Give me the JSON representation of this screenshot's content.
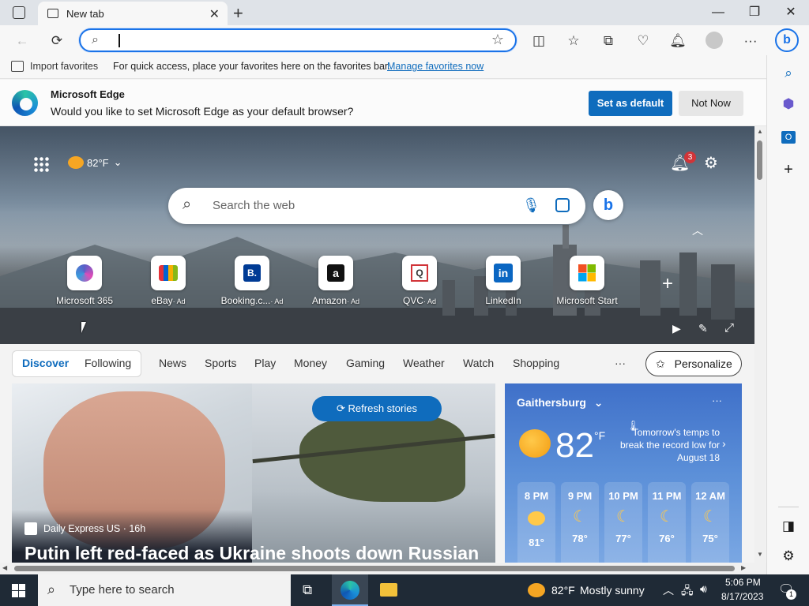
{
  "tab": {
    "title": "New tab"
  },
  "window": {
    "minimize": "—",
    "restore": "❐",
    "close": "✕"
  },
  "favbar": {
    "import_label": "Import favorites",
    "message": "For quick access, place your favorites here on the favorites bar.",
    "manage_link": "Manage favorites now"
  },
  "infobar": {
    "title": "Microsoft Edge",
    "message": "Would you like to set Microsoft Edge as your default browser?",
    "set_default": "Set as default",
    "not_now": "Not Now"
  },
  "hero": {
    "weather_temp": "82°F",
    "notification_count": "3",
    "search_placeholder": "Search the web",
    "quick_links": [
      {
        "name": "Microsoft 365",
        "ad": ""
      },
      {
        "name": "eBay",
        "ad": "· Ad"
      },
      {
        "name": "Booking.c...",
        "ad": "· Ad"
      },
      {
        "name": "Amazon",
        "ad": "· Ad"
      },
      {
        "name": "QVC",
        "ad": "· Ad"
      },
      {
        "name": "LinkedIn",
        "ad": ""
      },
      {
        "name": "Microsoft Start",
        "ad": ""
      }
    ]
  },
  "feednav": {
    "tabs": [
      "Discover",
      "Following"
    ],
    "items": [
      "News",
      "Sports",
      "Play",
      "Money",
      "Gaming",
      "Weather",
      "Watch",
      "Shopping"
    ],
    "more": "···",
    "personalize": "Personalize"
  },
  "story": {
    "refresh": "Refresh stories",
    "source": "Daily Express US · 16h",
    "headline": "Putin left red-faced as Ukraine shoots down Russian"
  },
  "weather_card": {
    "location": "Gaithersburg",
    "temp": "82",
    "unit": "°F",
    "note": "Tomorrow's temps to break the record low for August 18",
    "hours": [
      {
        "time": "8 PM",
        "temp": "81°"
      },
      {
        "time": "9 PM",
        "temp": "78°"
      },
      {
        "time": "10 PM",
        "temp": "77°"
      },
      {
        "time": "11 PM",
        "temp": "76°"
      },
      {
        "time": "12 AM",
        "temp": "75°"
      }
    ]
  },
  "taskbar": {
    "search_placeholder": "Type here to search",
    "weather": "82°F",
    "weather_desc": "Mostly sunny",
    "time": "5:06 PM",
    "date": "8/17/2023",
    "notif_count": "1"
  }
}
